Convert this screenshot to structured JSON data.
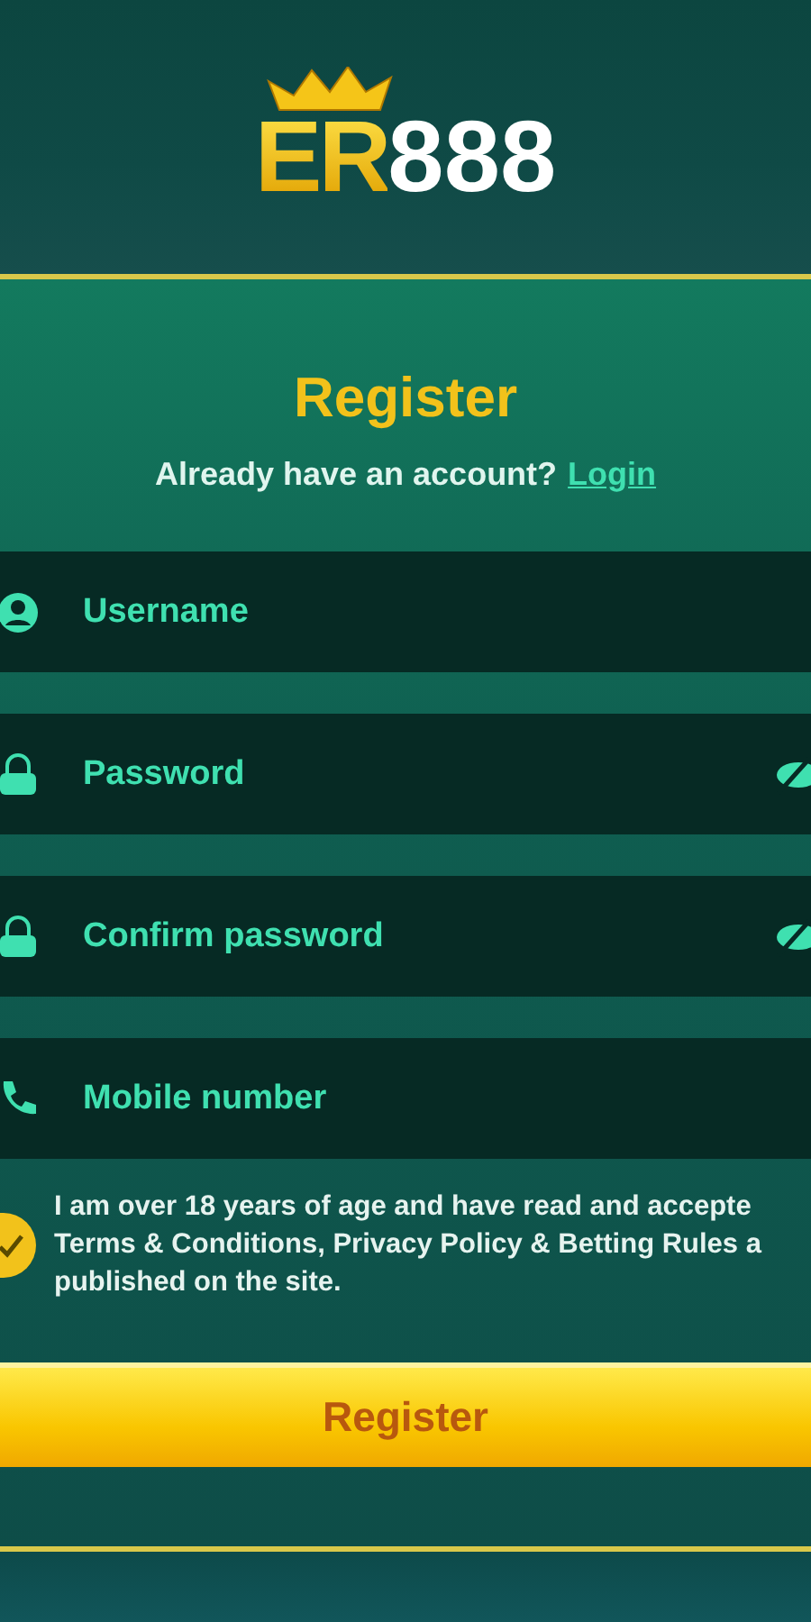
{
  "logo": {
    "part_1": "ER",
    "part_2": "888"
  },
  "form": {
    "title": "Register",
    "prompt": "Already have an account?",
    "login_link": "Login",
    "fields": [
      {
        "kind": "user",
        "placeholder": "Username",
        "eye_toggle": false
      },
      {
        "kind": "lock",
        "placeholder": "Password",
        "eye_toggle": true
      },
      {
        "kind": "lock",
        "placeholder": "Confirm password",
        "eye_toggle": true
      },
      {
        "kind": "phone",
        "placeholder": "Mobile number",
        "eye_toggle": false
      }
    ],
    "agreement": {
      "checked": true,
      "lines": [
        "I am over 18 years of age and have read and accepte",
        "Terms & Conditions, Privacy Policy & Betting Rules a",
        "published on the site."
      ]
    },
    "submit": "Register"
  }
}
